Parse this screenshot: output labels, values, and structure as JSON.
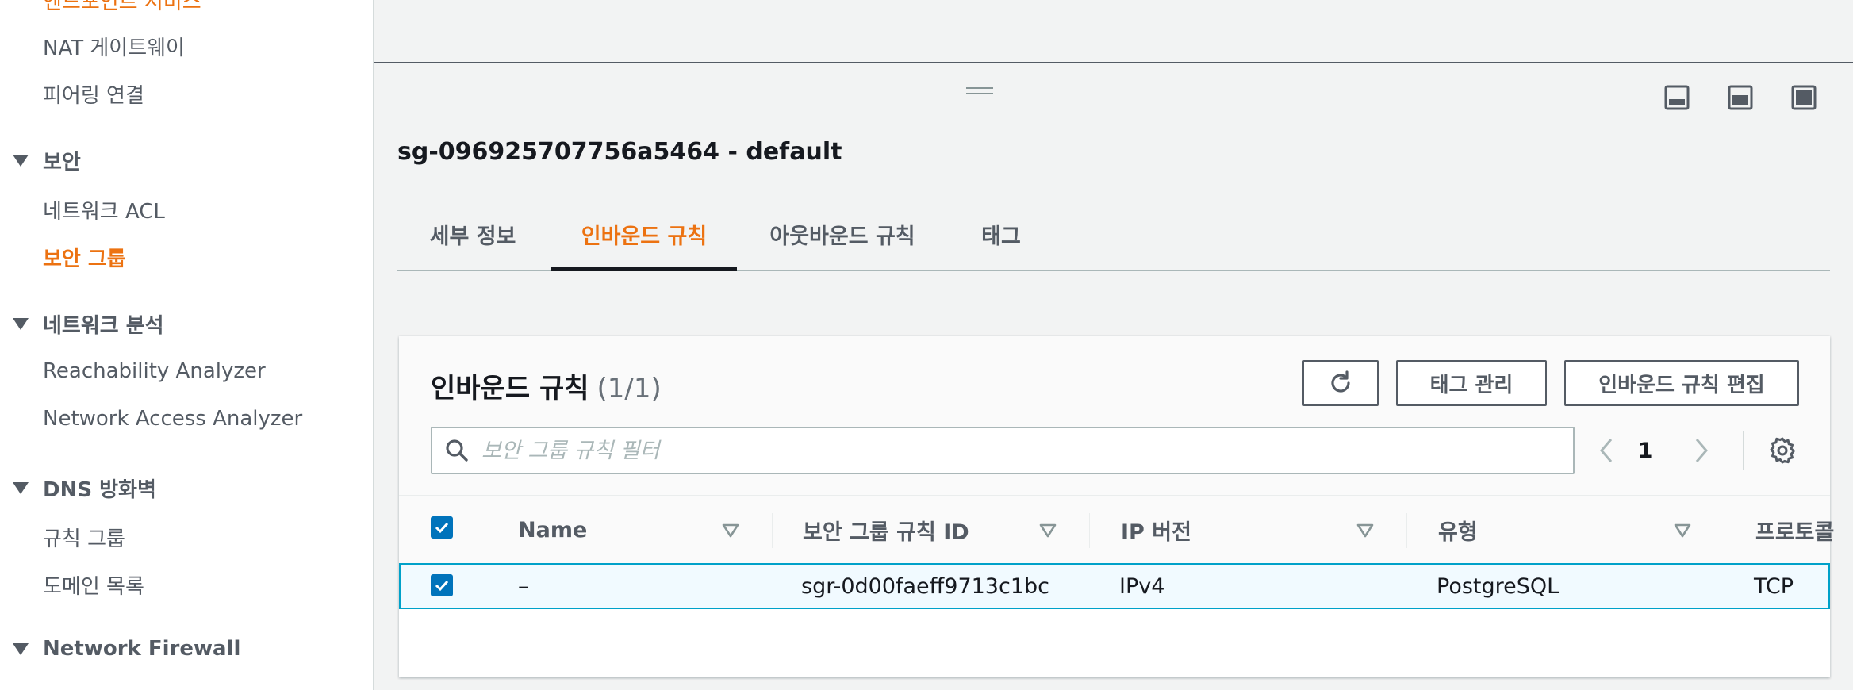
{
  "sidebar": {
    "items": [
      {
        "label": "엔드포인트 서비스"
      },
      {
        "label": "NAT 게이트웨이"
      },
      {
        "label": "피어링 연결"
      },
      {
        "label": "보안"
      },
      {
        "label": "네트워크 ACL"
      },
      {
        "label": "보안 그룹"
      },
      {
        "label": "네트워크 분석"
      },
      {
        "label": "Reachability Analyzer"
      },
      {
        "label": "Network Access Analyzer"
      },
      {
        "label": "DNS 방화벽"
      },
      {
        "label": "규칙 그룹"
      },
      {
        "label": "도메인 목록"
      },
      {
        "label": "Network Firewall"
      }
    ]
  },
  "panel": {
    "title": "sg-096925707756a5464 - default",
    "tabs": [
      {
        "label": "세부 정보"
      },
      {
        "label": "인바운드 규칙"
      },
      {
        "label": "아웃바운드 규칙"
      },
      {
        "label": "태그"
      }
    ],
    "active_tab": "인바운드 규칙"
  },
  "rules": {
    "title": "인바운드 규칙",
    "count": "(1/1)",
    "buttons": {
      "manage_tags": "태그 관리",
      "edit_inbound": "인바운드 규칙 편집"
    },
    "search_placeholder": "보안 그룹 규칙 필터",
    "page": "1",
    "columns": [
      "Name",
      "보안 그룹 규칙 ID",
      "IP 버전",
      "유형",
      "프로토콜"
    ],
    "rows": [
      {
        "name": "–",
        "rule_id": "sgr-0d00faeff9713c1bc",
        "ip_version": "IPv4",
        "type": "PostgreSQL",
        "protocol": "TCP",
        "selected": true
      }
    ]
  },
  "colors": {
    "accent": "#ec7211",
    "primary_blue": "#0073bb",
    "row_highlight_border": "#00a1c9"
  }
}
